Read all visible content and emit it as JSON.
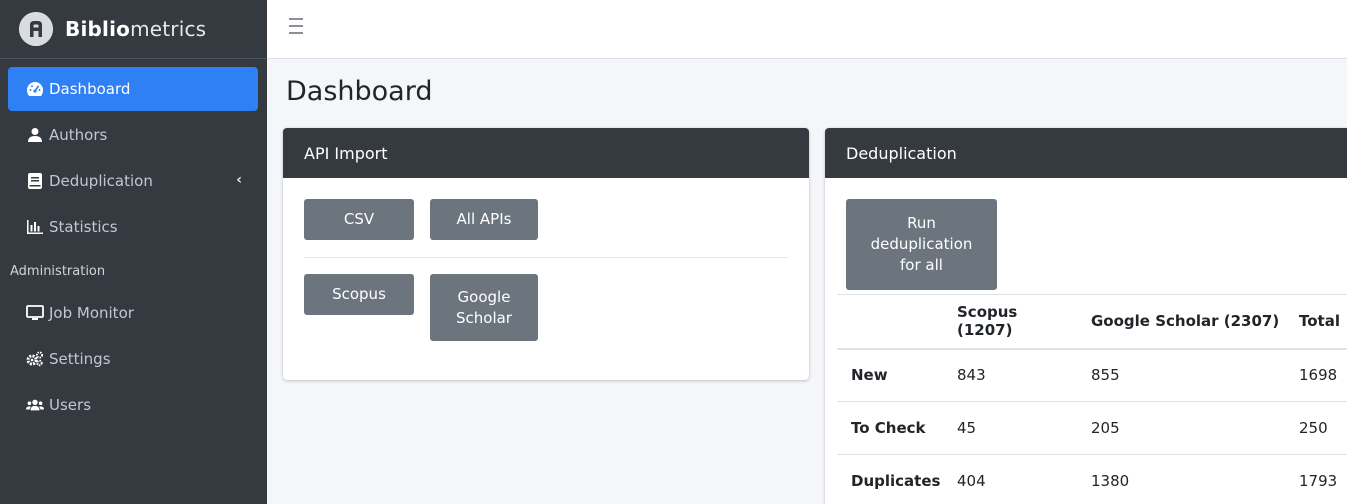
{
  "brand": {
    "bold": "Biblio",
    "rest": "metrics"
  },
  "sidebar": {
    "items": [
      {
        "label": "Dashboard",
        "icon": "tachometer-icon",
        "active": true
      },
      {
        "label": "Authors",
        "icon": "user-icon"
      },
      {
        "label": "Deduplication",
        "icon": "book-icon",
        "caret": "‹"
      },
      {
        "label": "Statistics",
        "icon": "chart-bar-icon"
      }
    ],
    "header": "Administration",
    "admin_items": [
      {
        "label": "Job Monitor",
        "icon": "desktop-icon"
      },
      {
        "label": "Settings",
        "icon": "cogs-icon"
      },
      {
        "label": "Users",
        "icon": "users-icon"
      }
    ]
  },
  "page": {
    "title": "Dashboard"
  },
  "api_import": {
    "title": "API Import",
    "buttons": {
      "csv": "CSV",
      "all_apis": "All APIs",
      "scopus": "Scopus",
      "google_scholar": "Google Scholar"
    }
  },
  "dedup": {
    "title": "Deduplication",
    "run_button": "Run deduplication for all",
    "table": {
      "headers": [
        "",
        "Scopus (1207)",
        "Google Scholar (2307)",
        "Total"
      ],
      "rows": [
        {
          "label": "New",
          "scopus": "843",
          "scholar": "855",
          "total": "1698"
        },
        {
          "label": "To Check",
          "scopus": "45",
          "scholar": "205",
          "total": "250"
        },
        {
          "label": "Duplicates",
          "scopus": "404",
          "scholar": "1380",
          "total": "1793"
        }
      ]
    }
  },
  "colors": {
    "sidebar": "#343a40",
    "active": "#2f7ff5",
    "button": "#6c757d",
    "card_header": "#343a40"
  }
}
